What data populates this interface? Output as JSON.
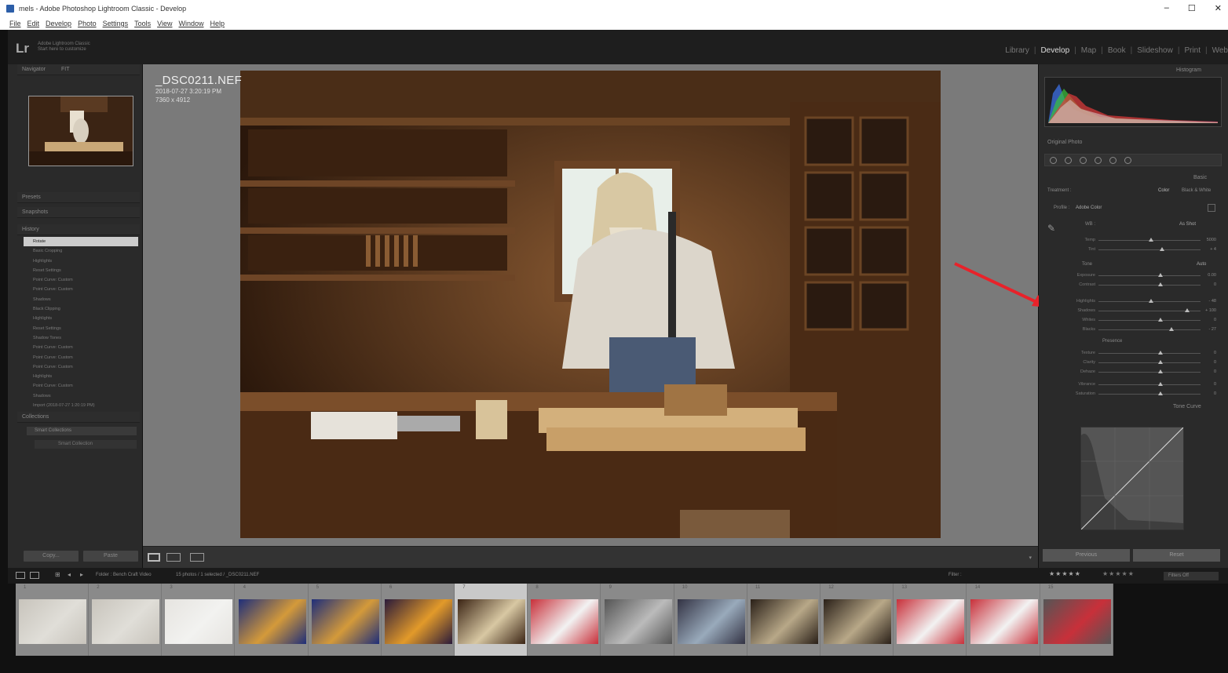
{
  "window": {
    "title": "mels - Adobe Photoshop Lightroom Classic - Develop",
    "controls": [
      "–",
      "☐",
      "✕"
    ]
  },
  "menu": [
    "File",
    "Edit",
    "Develop",
    "Photo",
    "Settings",
    "Tools",
    "View",
    "Window",
    "Help"
  ],
  "identity": {
    "logo": "Lr",
    "line1": "Adobe Lightroom Classic",
    "line2": "Start here to customize"
  },
  "modules": [
    "Library",
    "Develop",
    "Map",
    "Book",
    "Slideshow",
    "Print",
    "Web"
  ],
  "active_module": "Develop",
  "left_panel": {
    "navigator": "Navigator",
    "navigator_zoom": "FIT",
    "presets": "Presets",
    "snapshots": "Snapshots",
    "history": "History",
    "collections": "Collections",
    "history_items": [
      "Rotate",
      "Basic Cropping",
      "Highlights",
      "Reset Settings",
      "Point Curve: Custom",
      "Point Curve: Custom",
      "Shadows",
      "Black Clipping",
      "Highlights",
      "Reset Settings",
      "Shadow Tones",
      "Point Curve: Custom",
      "Point Curve: Custom",
      "Point Curve: Custom",
      "Highlights",
      "Point Curve: Custom",
      "Shadows",
      "Import (2018-07-27 1:20:19 PM)"
    ],
    "collection_items": [
      "Smart Collections",
      "Smart Collection"
    ],
    "copy_btn": "Copy...",
    "paste_btn": "Paste"
  },
  "photo": {
    "filename": "_DSC0211.NEF",
    "datetime": "2018-07-27 3:20:19 PM",
    "dimensions": "7360 x 4912"
  },
  "right_panel": {
    "histogram": "Histogram",
    "original_photo": "Original Photo",
    "basic": "Basic",
    "tone_curve": "Tone Curve",
    "treatment_label": "Treatment :",
    "treatment_color": "Color",
    "treatment_bw": "Black & White",
    "profile_label": "Profile :",
    "profile_value": "Adobe Color",
    "wb_label": "WB :",
    "wb_value": "As Shot",
    "tone_label": "Tone",
    "tone_auto": "Auto",
    "presence_label": "Presence",
    "sliders": [
      {
        "label": "Temp",
        "value": "5000"
      },
      {
        "label": "Tint",
        "value": "+ 4"
      },
      {
        "label": "Exposure",
        "value": "0.00"
      },
      {
        "label": "Contrast",
        "value": "0"
      },
      {
        "label": "Highlights",
        "value": "- 48"
      },
      {
        "label": "Shadows",
        "value": "+ 100"
      },
      {
        "label": "Whites",
        "value": "0"
      },
      {
        "label": "Blacks",
        "value": "- 27"
      },
      {
        "label": "Texture",
        "value": "0"
      },
      {
        "label": "Clarity",
        "value": "0"
      },
      {
        "label": "Dehaze",
        "value": "0"
      },
      {
        "label": "Vibrance",
        "value": "0"
      },
      {
        "label": "Saturation",
        "value": "0"
      }
    ],
    "previous_btn": "Previous",
    "reset_btn": "Reset"
  },
  "filmstrip": {
    "source": "Folder : Bench Craft Video",
    "count": "15 photos / 1 selected / _DSC0211.NEF",
    "filter": "Filter :",
    "filters_off": "Filters Off",
    "numbers": [
      "1",
      "2",
      "3",
      "4",
      "5",
      "6",
      "7",
      "8",
      "9",
      "10",
      "11",
      "12",
      "13",
      "14",
      "15"
    ],
    "selected_index": 7
  },
  "colors": {
    "accent_arrow": "#e8222a",
    "panel_bg": "#2a2a2a",
    "center_bg": "#7a7a7a"
  }
}
